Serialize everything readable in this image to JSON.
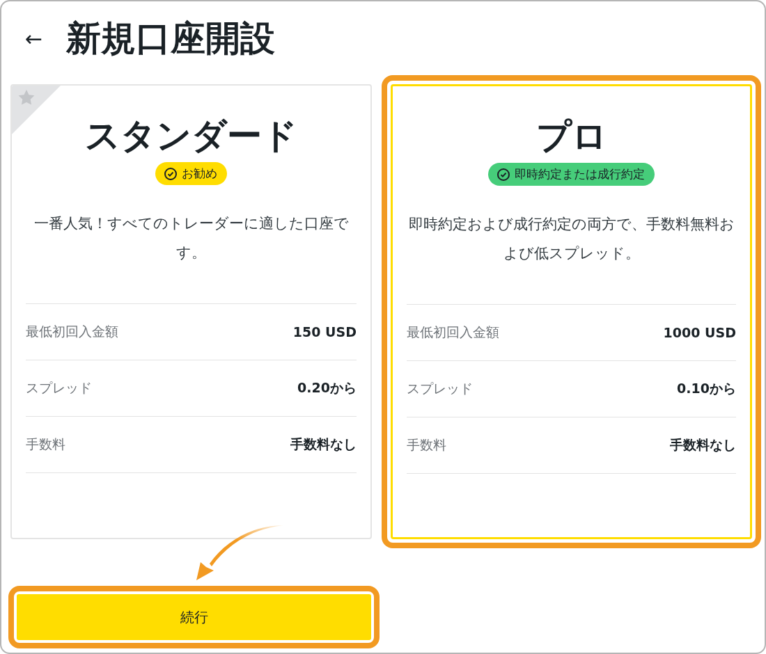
{
  "header": {
    "back": "←",
    "title": "新規口座開設"
  },
  "plans": [
    {
      "name": "スタンダード",
      "ribbon": true,
      "selected": false,
      "highlighted": false,
      "badge": {
        "label": "お勧め",
        "color": "#ffdd00"
      },
      "description": "一番人気！すべてのトレーダーに適した口座です。",
      "rows": [
        {
          "label": "最低初回入金額",
          "value": "150 USD"
        },
        {
          "label": "スプレッド",
          "value": "0.20から"
        },
        {
          "label": "手数料",
          "value": "手数料なし"
        }
      ]
    },
    {
      "name": "プロ",
      "ribbon": false,
      "selected": true,
      "highlighted": true,
      "badge": {
        "label": "即時約定または成行約定",
        "color": "#46cd7a"
      },
      "description": "即時約定および成行約定の両方で、手数料無料および低スプレッド。",
      "rows": [
        {
          "label": "最低初回入金額",
          "value": "1000 USD"
        },
        {
          "label": "スプレッド",
          "value": "0.10から"
        },
        {
          "label": "手数料",
          "value": "手数料なし"
        }
      ]
    }
  ],
  "continue_button": {
    "label": "続行",
    "highlighted": true,
    "pointer_arrow": true
  }
}
